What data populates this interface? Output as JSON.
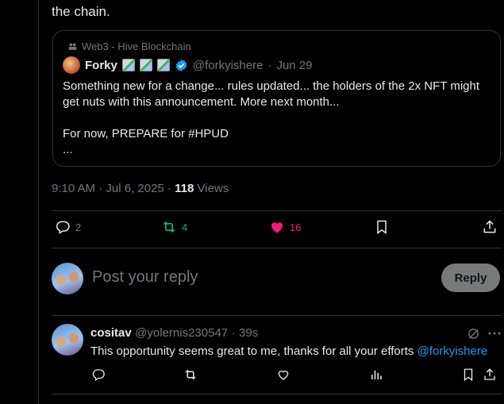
{
  "tweet": {
    "text_tail": "the chain.",
    "time": "9:10 AM",
    "date": "Jul 6, 2025",
    "views_count": "118",
    "views_label": "Views"
  },
  "quote": {
    "community": "Web3 - Hive Blockchain",
    "author_name": "Forky",
    "handle": "@forkyishere",
    "date": "Jun 29",
    "body": "Something new for a change... rules updated... the holders of the 2x NFT might get nuts with this announcement. More next month...\n\nFor now, PREPARE for #HPUD\n..."
  },
  "actions": {
    "replies": "2",
    "reposts": "4",
    "likes": "16"
  },
  "reply_box": {
    "placeholder": "Post your reply",
    "button_label": "Reply"
  },
  "comment": {
    "name": "cositav",
    "handle": "@yolernis230547",
    "time": "39s",
    "text": "This opportunity seems great to me, thanks for all your efforts",
    "mention": "@forkyishere"
  },
  "colors": {
    "repost_green": "#00ba7c",
    "like_pink": "#f91880",
    "link_blue": "#1d9bf0",
    "muted": "#71767b"
  }
}
